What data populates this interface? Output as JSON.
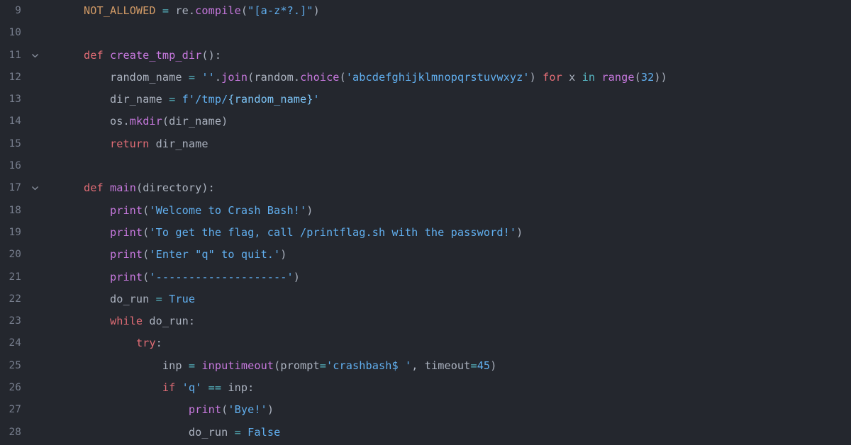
{
  "editor": {
    "language": "python",
    "theme": "one-dark",
    "colors": {
      "background": "#24272e",
      "gutter_text": "#767d8c",
      "default_text": "#abb2bf",
      "keyword": "#e06c75",
      "function": "#c678dd",
      "string": "#61afef",
      "constant": "#d19a66",
      "operator": "#56b6c2",
      "number": "#61afef"
    },
    "first_visible_line": 9,
    "last_visible_line": 28,
    "fold_icon": "chevron-down-icon"
  },
  "lines": [
    {
      "number": "9",
      "fold": false,
      "tokens": [
        {
          "t": "    ",
          "c": "t-punct"
        },
        {
          "t": "NOT_ALLOWED",
          "c": "t-const-up"
        },
        {
          "t": " ",
          "c": "t-punct"
        },
        {
          "t": "=",
          "c": "t-op"
        },
        {
          "t": " ",
          "c": "t-punct"
        },
        {
          "t": "re",
          "c": "t-var"
        },
        {
          "t": ".",
          "c": "t-punct"
        },
        {
          "t": "compile",
          "c": "t-fn"
        },
        {
          "t": "(",
          "c": "t-punct"
        },
        {
          "t": "\"[a-z*?.]\"",
          "c": "t-str"
        },
        {
          "t": ")",
          "c": "t-punct"
        }
      ]
    },
    {
      "number": "10",
      "fold": false,
      "tokens": []
    },
    {
      "number": "11",
      "fold": true,
      "tokens": [
        {
          "t": "    ",
          "c": "t-punct"
        },
        {
          "t": "def",
          "c": "t-kw"
        },
        {
          "t": " ",
          "c": "t-punct"
        },
        {
          "t": "create_tmp_dir",
          "c": "t-fn"
        },
        {
          "t": "():",
          "c": "t-punct"
        }
      ]
    },
    {
      "number": "12",
      "fold": false,
      "tokens": [
        {
          "t": "        ",
          "c": "t-punct"
        },
        {
          "t": "random_name",
          "c": "t-var"
        },
        {
          "t": " ",
          "c": "t-punct"
        },
        {
          "t": "=",
          "c": "t-op"
        },
        {
          "t": " ",
          "c": "t-punct"
        },
        {
          "t": "''",
          "c": "t-str"
        },
        {
          "t": ".",
          "c": "t-punct"
        },
        {
          "t": "join",
          "c": "t-fn"
        },
        {
          "t": "(",
          "c": "t-punct"
        },
        {
          "t": "random",
          "c": "t-var"
        },
        {
          "t": ".",
          "c": "t-punct"
        },
        {
          "t": "choice",
          "c": "t-fn"
        },
        {
          "t": "(",
          "c": "t-punct"
        },
        {
          "t": "'abcdefghijklmnopqrstuvwxyz'",
          "c": "t-str"
        },
        {
          "t": ")",
          "c": "t-punct"
        },
        {
          "t": " ",
          "c": "t-punct"
        },
        {
          "t": "for",
          "c": "t-kw"
        },
        {
          "t": " ",
          "c": "t-punct"
        },
        {
          "t": "x",
          "c": "t-var"
        },
        {
          "t": " ",
          "c": "t-punct"
        },
        {
          "t": "in",
          "c": "t-kw2"
        },
        {
          "t": " ",
          "c": "t-punct"
        },
        {
          "t": "range",
          "c": "t-fn"
        },
        {
          "t": "(",
          "c": "t-punct"
        },
        {
          "t": "32",
          "c": "t-const"
        },
        {
          "t": "))",
          "c": "t-punct"
        }
      ]
    },
    {
      "number": "13",
      "fold": false,
      "tokens": [
        {
          "t": "        ",
          "c": "t-punct"
        },
        {
          "t": "dir_name",
          "c": "t-var"
        },
        {
          "t": " ",
          "c": "t-punct"
        },
        {
          "t": "=",
          "c": "t-op"
        },
        {
          "t": " ",
          "c": "t-punct"
        },
        {
          "t": "f",
          "c": "t-const"
        },
        {
          "t": "'/tmp/",
          "c": "t-str"
        },
        {
          "t": "{random_name}",
          "c": "t-strlit"
        },
        {
          "t": "'",
          "c": "t-str"
        }
      ]
    },
    {
      "number": "14",
      "fold": false,
      "tokens": [
        {
          "t": "        ",
          "c": "t-punct"
        },
        {
          "t": "os",
          "c": "t-var"
        },
        {
          "t": ".",
          "c": "t-punct"
        },
        {
          "t": "mkdir",
          "c": "t-fn"
        },
        {
          "t": "(",
          "c": "t-punct"
        },
        {
          "t": "dir_name",
          "c": "t-var"
        },
        {
          "t": ")",
          "c": "t-punct"
        }
      ]
    },
    {
      "number": "15",
      "fold": false,
      "tokens": [
        {
          "t": "        ",
          "c": "t-punct"
        },
        {
          "t": "return",
          "c": "t-kw"
        },
        {
          "t": " ",
          "c": "t-punct"
        },
        {
          "t": "dir_name",
          "c": "t-var"
        }
      ]
    },
    {
      "number": "16",
      "fold": false,
      "tokens": []
    },
    {
      "number": "17",
      "fold": true,
      "tokens": [
        {
          "t": "    ",
          "c": "t-punct"
        },
        {
          "t": "def",
          "c": "t-kw"
        },
        {
          "t": " ",
          "c": "t-punct"
        },
        {
          "t": "main",
          "c": "t-fn"
        },
        {
          "t": "(",
          "c": "t-punct"
        },
        {
          "t": "directory",
          "c": "t-var"
        },
        {
          "t": "):",
          "c": "t-punct"
        }
      ]
    },
    {
      "number": "18",
      "fold": false,
      "tokens": [
        {
          "t": "        ",
          "c": "t-punct"
        },
        {
          "t": "print",
          "c": "t-fn"
        },
        {
          "t": "(",
          "c": "t-punct"
        },
        {
          "t": "'Welcome to Crash Bash!'",
          "c": "t-str"
        },
        {
          "t": ")",
          "c": "t-punct"
        }
      ]
    },
    {
      "number": "19",
      "fold": false,
      "tokens": [
        {
          "t": "        ",
          "c": "t-punct"
        },
        {
          "t": "print",
          "c": "t-fn"
        },
        {
          "t": "(",
          "c": "t-punct"
        },
        {
          "t": "'To get the flag, call /printflag.sh with the password!'",
          "c": "t-str"
        },
        {
          "t": ")",
          "c": "t-punct"
        }
      ]
    },
    {
      "number": "20",
      "fold": false,
      "tokens": [
        {
          "t": "        ",
          "c": "t-punct"
        },
        {
          "t": "print",
          "c": "t-fn"
        },
        {
          "t": "(",
          "c": "t-punct"
        },
        {
          "t": "'Enter \"q\" to quit.'",
          "c": "t-str"
        },
        {
          "t": ")",
          "c": "t-punct"
        }
      ]
    },
    {
      "number": "21",
      "fold": false,
      "tokens": [
        {
          "t": "        ",
          "c": "t-punct"
        },
        {
          "t": "print",
          "c": "t-fn"
        },
        {
          "t": "(",
          "c": "t-punct"
        },
        {
          "t": "'--------------------'",
          "c": "t-str"
        },
        {
          "t": ")",
          "c": "t-punct"
        }
      ]
    },
    {
      "number": "22",
      "fold": false,
      "tokens": [
        {
          "t": "        ",
          "c": "t-punct"
        },
        {
          "t": "do_run",
          "c": "t-var"
        },
        {
          "t": " ",
          "c": "t-punct"
        },
        {
          "t": "=",
          "c": "t-op"
        },
        {
          "t": " ",
          "c": "t-punct"
        },
        {
          "t": "True",
          "c": "t-const"
        }
      ]
    },
    {
      "number": "23",
      "fold": false,
      "tokens": [
        {
          "t": "        ",
          "c": "t-punct"
        },
        {
          "t": "while",
          "c": "t-kw"
        },
        {
          "t": " ",
          "c": "t-punct"
        },
        {
          "t": "do_run",
          "c": "t-var"
        },
        {
          "t": ":",
          "c": "t-punct"
        }
      ]
    },
    {
      "number": "24",
      "fold": false,
      "tokens": [
        {
          "t": "            ",
          "c": "t-punct"
        },
        {
          "t": "try",
          "c": "t-kw"
        },
        {
          "t": ":",
          "c": "t-punct"
        }
      ]
    },
    {
      "number": "25",
      "fold": false,
      "tokens": [
        {
          "t": "                ",
          "c": "t-punct"
        },
        {
          "t": "inp",
          "c": "t-var"
        },
        {
          "t": " ",
          "c": "t-punct"
        },
        {
          "t": "=",
          "c": "t-op"
        },
        {
          "t": " ",
          "c": "t-punct"
        },
        {
          "t": "inputimeout",
          "c": "t-fn"
        },
        {
          "t": "(",
          "c": "t-punct"
        },
        {
          "t": "prompt",
          "c": "t-var"
        },
        {
          "t": "=",
          "c": "t-op"
        },
        {
          "t": "'crashbash$ '",
          "c": "t-str"
        },
        {
          "t": ", ",
          "c": "t-punct"
        },
        {
          "t": "timeout",
          "c": "t-var"
        },
        {
          "t": "=",
          "c": "t-op"
        },
        {
          "t": "45",
          "c": "t-const"
        },
        {
          "t": ")",
          "c": "t-punct"
        }
      ]
    },
    {
      "number": "26",
      "fold": false,
      "tokens": [
        {
          "t": "                ",
          "c": "t-punct"
        },
        {
          "t": "if",
          "c": "t-kw"
        },
        {
          "t": " ",
          "c": "t-punct"
        },
        {
          "t": "'q'",
          "c": "t-str"
        },
        {
          "t": " ",
          "c": "t-punct"
        },
        {
          "t": "==",
          "c": "t-op"
        },
        {
          "t": " ",
          "c": "t-punct"
        },
        {
          "t": "inp",
          "c": "t-var"
        },
        {
          "t": ":",
          "c": "t-punct"
        }
      ]
    },
    {
      "number": "27",
      "fold": false,
      "tokens": [
        {
          "t": "                    ",
          "c": "t-punct"
        },
        {
          "t": "print",
          "c": "t-fn"
        },
        {
          "t": "(",
          "c": "t-punct"
        },
        {
          "t": "'Bye!'",
          "c": "t-str"
        },
        {
          "t": ")",
          "c": "t-punct"
        }
      ]
    },
    {
      "number": "28",
      "fold": false,
      "tokens": [
        {
          "t": "                    ",
          "c": "t-punct"
        },
        {
          "t": "do_run",
          "c": "t-var"
        },
        {
          "t": " ",
          "c": "t-punct"
        },
        {
          "t": "=",
          "c": "t-op"
        },
        {
          "t": " ",
          "c": "t-punct"
        },
        {
          "t": "False",
          "c": "t-const"
        }
      ]
    }
  ]
}
